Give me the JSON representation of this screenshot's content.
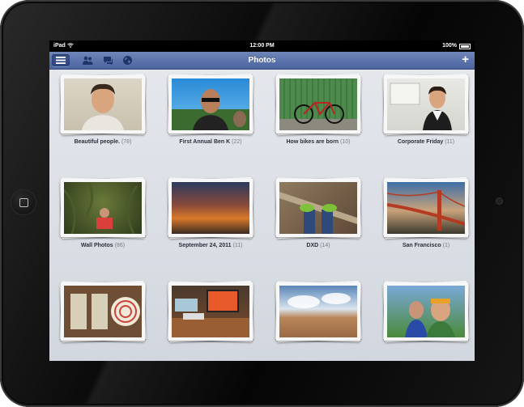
{
  "status": {
    "carrier": "iPad",
    "time": "12:00 PM",
    "battery": "100%"
  },
  "nav": {
    "title": "Photos",
    "add_label": "+"
  },
  "icons": {
    "menu": "menu-icon",
    "friends": "friends-icon",
    "messages": "messages-icon",
    "notifications": "globe-icon",
    "wifi": "wifi-icon",
    "battery": "battery-icon"
  },
  "colors": {
    "nav_bar": "#5a72aa",
    "background": "#dde1e8",
    "caption": "#2a2f3a",
    "count": "#777d88"
  },
  "albums": [
    {
      "name": "Beautiful people.",
      "count": "(78)"
    },
    {
      "name": "First Annual Ben K",
      "count": "(22)"
    },
    {
      "name": "How bikes are born",
      "count": "(10)"
    },
    {
      "name": "Corporate Friday",
      "count": "(11)"
    },
    {
      "name": "Wall Photos",
      "count": "(86)"
    },
    {
      "name": "September 24, 2011",
      "count": "(11)"
    },
    {
      "name": "DXD",
      "count": "(14)"
    },
    {
      "name": "San Francisco",
      "count": "(1)"
    },
    {
      "name": "",
      "count": ""
    },
    {
      "name": "",
      "count": ""
    },
    {
      "name": "",
      "count": ""
    },
    {
      "name": "",
      "count": ""
    }
  ]
}
